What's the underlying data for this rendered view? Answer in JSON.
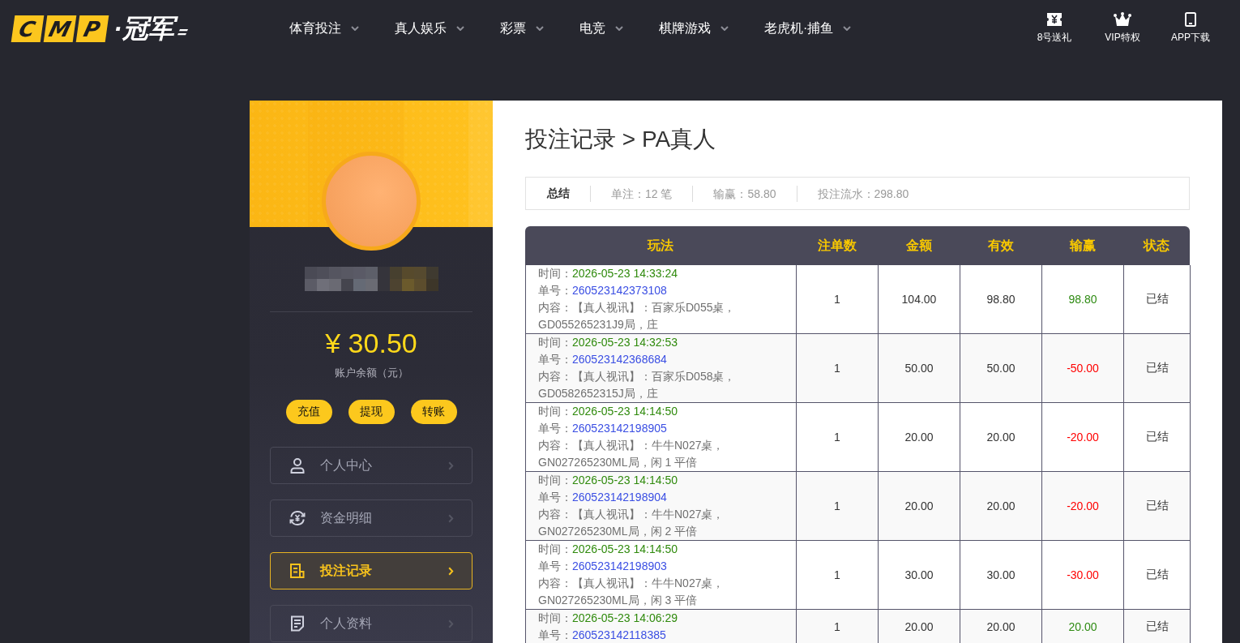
{
  "nav": {
    "logo": {
      "letters": [
        "C",
        "M",
        "P"
      ],
      "name": "·冠军"
    },
    "items": [
      "体育投注",
      "真人娱乐",
      "彩票",
      "电竞",
      "棋牌游戏",
      "老虎机·捕鱼"
    ],
    "shortcuts": [
      "8号送礼",
      "VIP特权",
      "APP下载"
    ]
  },
  "account": {
    "balance": "¥ 30.50",
    "balance_label": "账户余额（元）",
    "actions": [
      "充值",
      "提现",
      "转账"
    ],
    "menu": [
      {
        "label": "个人中心",
        "selected": false
      },
      {
        "label": "资金明细",
        "selected": false
      },
      {
        "label": "投注记录",
        "selected": true
      },
      {
        "label": "个人资料",
        "selected": false
      }
    ]
  },
  "page": {
    "title": "投注记录 > PA真人",
    "summary": {
      "label": "总结",
      "items": [
        "单注：12 笔",
        "输赢：58.80",
        "投注流水：298.80"
      ]
    }
  },
  "table": {
    "columns": [
      "玩法",
      "注单数",
      "金额",
      "有效",
      "输赢",
      "状态"
    ],
    "rows": [
      {
        "time_label": "时间：",
        "time": "2026-05-23 14:33:24",
        "order_label": "单号：",
        "order_no": "260523142373108",
        "content": "内容：【真人视讯】：百家乐D055桌，GD055265231J9局，庄",
        "count": "1",
        "amount": "104.00",
        "valid": "98.80",
        "winloss": {
          "text": "98.80",
          "color": "#2e8b12"
        },
        "status": "已结"
      },
      {
        "time_label": "时间：",
        "time": "2026-05-23 14:32:53",
        "order_label": "单号：",
        "order_no": "260523142368684",
        "content": "内容：【真人视讯】：百家乐D058桌，GD0582652315J局，庄",
        "count": "1",
        "amount": "50.00",
        "valid": "50.00",
        "winloss": {
          "text": "-50.00",
          "color": "#ff0000"
        },
        "status": "已结"
      },
      {
        "time_label": "时间：",
        "time": "2026-05-23 14:14:50",
        "order_label": "单号：",
        "order_no": "260523142198905",
        "content": "内容：【真人视讯】：牛牛N027桌，GN027265230ML局，闲 1 平倍",
        "count": "1",
        "amount": "20.00",
        "valid": "20.00",
        "winloss": {
          "text": "-20.00",
          "color": "#ff0000"
        },
        "status": "已结"
      },
      {
        "time_label": "时间：",
        "time": "2026-05-23 14:14:50",
        "order_label": "单号：",
        "order_no": "260523142198904",
        "content": "内容：【真人视讯】：牛牛N027桌，GN027265230ML局，闲 2 平倍",
        "count": "1",
        "amount": "20.00",
        "valid": "20.00",
        "winloss": {
          "text": "-20.00",
          "color": "#ff0000"
        },
        "status": "已结"
      },
      {
        "time_label": "时间：",
        "time": "2026-05-23 14:14:50",
        "order_label": "单号：",
        "order_no": "260523142198903",
        "content": "内容：【真人视讯】：牛牛N027桌，GN027265230ML局，闲 3 平倍",
        "count": "1",
        "amount": "30.00",
        "valid": "30.00",
        "winloss": {
          "text": "-30.00",
          "color": "#ff0000"
        },
        "status": "已结"
      },
      {
        "time_label": "时间：",
        "time": "2026-05-23 14:06:29",
        "order_label": "单号：",
        "order_no": "260523142118385",
        "count": "1",
        "amount": "20.00",
        "valid": "20.00",
        "winloss": {
          "text": "20.00",
          "color": "#2e8b12"
        },
        "status": "已结"
      }
    ]
  }
}
